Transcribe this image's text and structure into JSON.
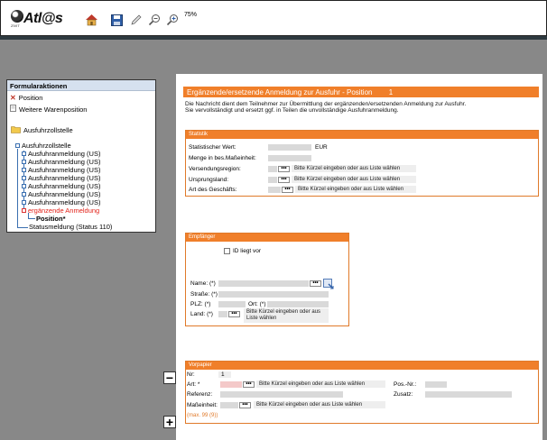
{
  "toolbar": {
    "logo_text": "Atl@s",
    "logo_sub": "ZIVIT",
    "zoom": "75%",
    "icons": [
      "home-icon",
      "save-icon",
      "pen-icon",
      "zoom-out-icon",
      "zoom-in-icon"
    ]
  },
  "left_panel": {
    "header": "Formularaktionen",
    "actions": [
      {
        "icon": "close-icon",
        "label": "Position"
      },
      {
        "icon": "document-icon",
        "label": "Weitere Warenposition"
      }
    ],
    "folder_label": "Ausfuhrzollstelle",
    "tree_root": "Ausfuhrzollstelle",
    "tree_items": [
      "Ausfuhranmeldung (US)",
      "Ausfuhranmeldung (US)",
      "Ausfuhranmeldung (US)",
      "Ausfuhranmeldung (US)",
      "Ausfuhranmeldung (US)",
      "Ausfuhranmeldung (US)",
      "Ausfuhranmeldung (US)"
    ],
    "tree_active": "ergänzende Anmeldung",
    "tree_child": "Position*",
    "tree_status": "Statusmeldung (Status 110)"
  },
  "form": {
    "title": "Ergänzende/ersetzende Anmeldung zur Ausfuhr - Position",
    "title_num": "1",
    "intro_line1": "Die Nachricht dient dem Teilnehmer zur Übermittlung der ergänzenden/ersetzenden Anmeldung zur Ausfuhr.",
    "intro_line2": "Sie vervollständigt und ersetzt ggf. in Teilen die unvollständige Ausfuhranmeldung.",
    "hint_text": "Bitte Kürzel eingeben oder aus Liste wählen",
    "dots": "•••",
    "statistik": {
      "header": "Statistik",
      "statistischer_wert": "Statistischer Wert:",
      "currency": "EUR",
      "menge": "Menge in bes.Maßeinheit:",
      "versendungsregion": "Versendungsregion:",
      "ursprungsland": "Ursprungsland:",
      "art_geschaefts": "Art des Geschäfts:"
    },
    "empfaenger": {
      "header": "Empfänger",
      "id_liegt_vor": "ID liegt vor",
      "name": "Name: (*)",
      "strasse": "Straße: (*)",
      "plz": "PLZ: (*)",
      "ort": "Ort: (*)",
      "land": "Land: (*)",
      "land_hint_1": "Bitte Kürzel eingeben oder aus",
      "land_hint_2": "Liste wählen"
    },
    "vorpapier": {
      "header": "Vorpapier",
      "nr": "Nr:",
      "nr_value": "1",
      "art": "Art: *",
      "referenz": "Referenz:",
      "masseinheit": "Maßeinheit:",
      "pos_nr": "Pos.-Nr.:",
      "zusatz": "Zusatz:",
      "max_note": "(max. 99 (9))"
    }
  },
  "side_buttons": {
    "minus": "−",
    "plus": "+"
  }
}
